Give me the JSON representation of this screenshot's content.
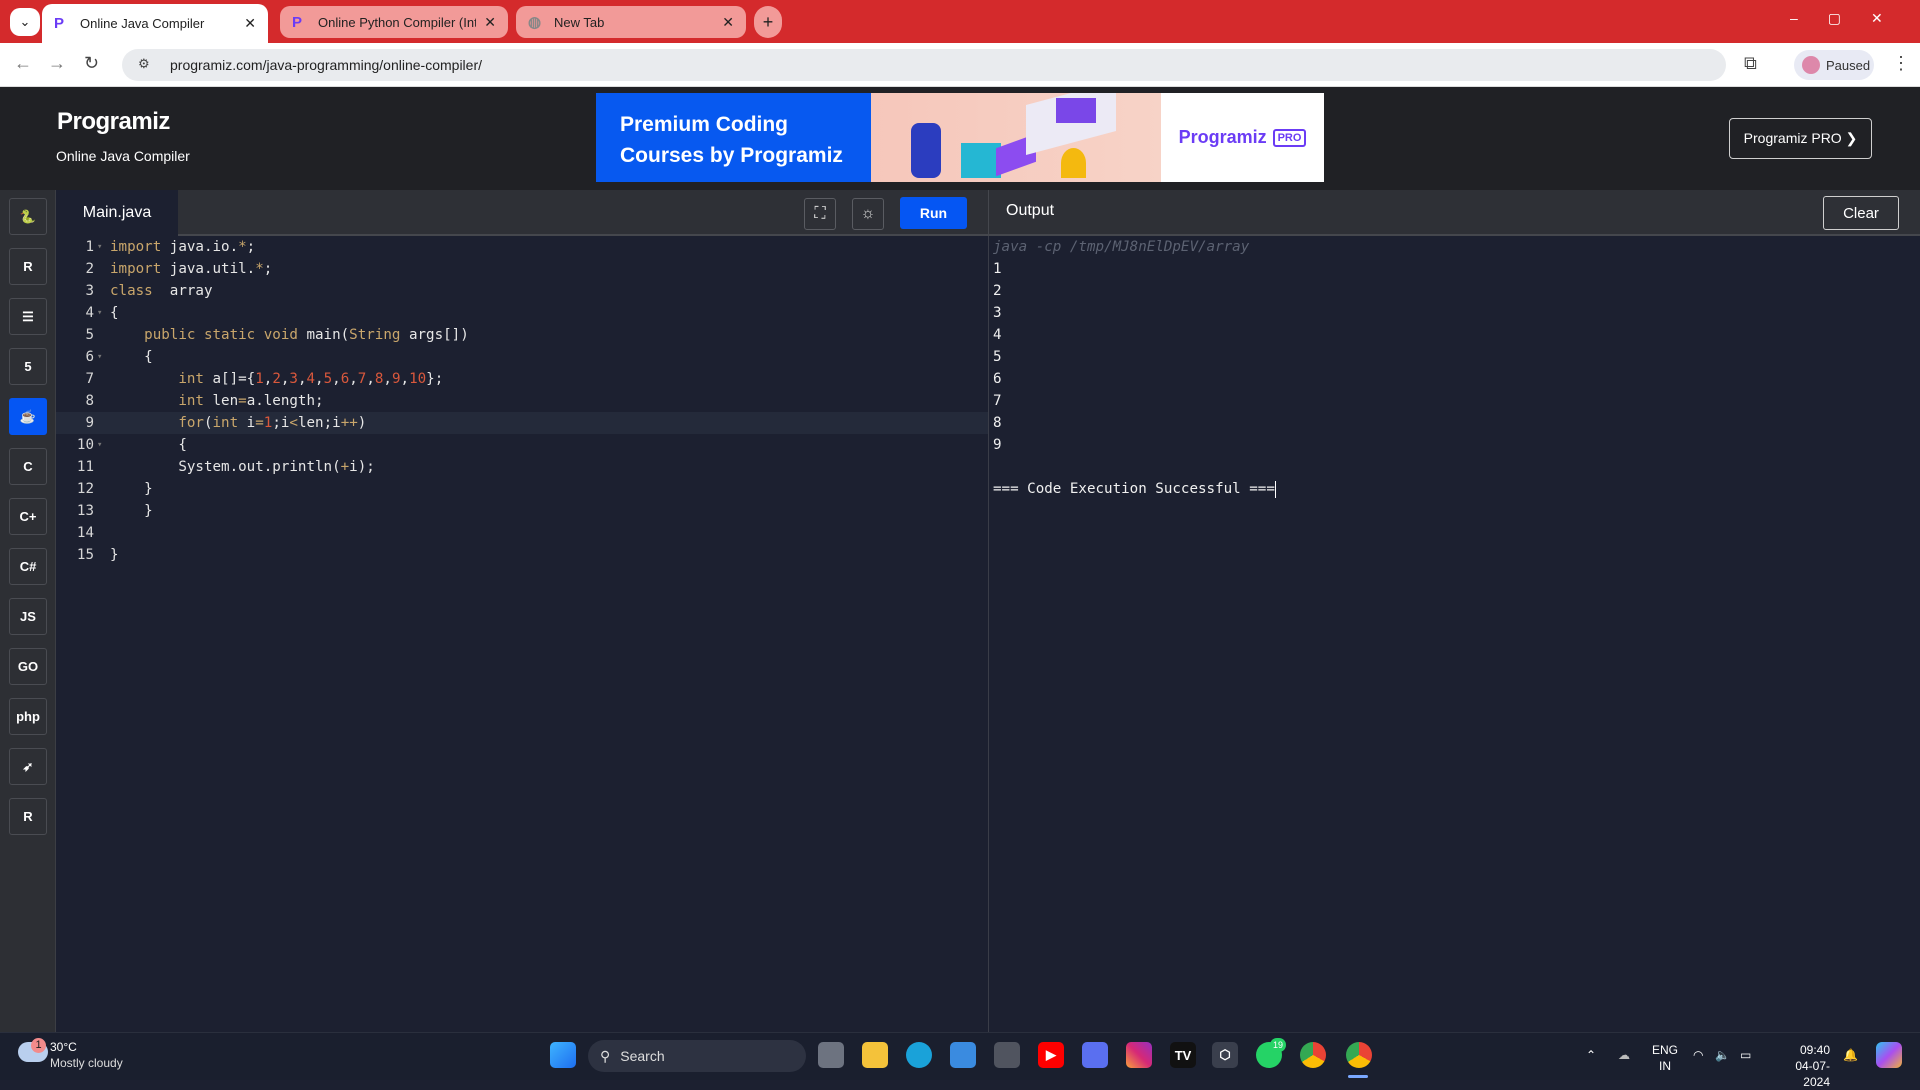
{
  "browser": {
    "tabs": [
      {
        "title": "Online Java Compiler",
        "active": true
      },
      {
        "title": "Online Python Compiler (Interpreter)",
        "active": false
      },
      {
        "title": "New Tab",
        "active": false
      }
    ],
    "url": "programiz.com/java-programming/online-compiler/",
    "profile_label": "Paused"
  },
  "header": {
    "logo": "Programiz",
    "subtitle": "Online Java Compiler",
    "ad_text_line1": "Premium Coding",
    "ad_text_line2": "Courses by Programiz",
    "ad_brand": "Programiz",
    "ad_badge": "PRO",
    "pro_button": "Programiz PRO ❯"
  },
  "sidebar": {
    "items": [
      {
        "name": "python",
        "glyph": "🐍"
      },
      {
        "name": "r",
        "glyph": "R"
      },
      {
        "name": "sql",
        "glyph": "☰"
      },
      {
        "name": "html",
        "glyph": "5"
      },
      {
        "name": "java",
        "glyph": "☕",
        "selected": true
      },
      {
        "name": "c",
        "glyph": "C"
      },
      {
        "name": "cpp",
        "glyph": "C+"
      },
      {
        "name": "csharp",
        "glyph": "C#"
      },
      {
        "name": "javascript",
        "glyph": "JS"
      },
      {
        "name": "go",
        "glyph": "GO"
      },
      {
        "name": "php",
        "glyph": "php"
      },
      {
        "name": "swift",
        "glyph": "➶"
      },
      {
        "name": "rust",
        "glyph": "R"
      }
    ]
  },
  "editor": {
    "filename": "Main.java",
    "run_label": "Run",
    "active_line": 9,
    "lines": [
      {
        "n": "1",
        "fold": true,
        "tokens": [
          [
            "import",
            "kw"
          ],
          [
            " java.io.",
            ""
          ],
          [
            "*",
            "op"
          ],
          [
            ";",
            ""
          ]
        ]
      },
      {
        "n": "2",
        "tokens": [
          [
            "import",
            "kw"
          ],
          [
            " java.util.",
            ""
          ],
          [
            "*",
            "op"
          ],
          [
            ";",
            ""
          ]
        ]
      },
      {
        "n": "3",
        "tokens": [
          [
            "class",
            "kw"
          ],
          [
            "  array",
            ""
          ]
        ]
      },
      {
        "n": "4",
        "fold": true,
        "tokens": [
          [
            "{",
            ""
          ]
        ]
      },
      {
        "n": "5",
        "tokens": [
          [
            "    ",
            ""
          ],
          [
            "public static void",
            "kw"
          ],
          [
            " main(",
            ""
          ],
          [
            "String",
            "kw"
          ],
          [
            " args[])",
            ""
          ]
        ]
      },
      {
        "n": "6",
        "fold": true,
        "tokens": [
          [
            "    {",
            ""
          ]
        ]
      },
      {
        "n": "7",
        "tokens": [
          [
            "        ",
            ""
          ],
          [
            "int",
            "kw"
          ],
          [
            " a[]={",
            ""
          ],
          [
            "1",
            "num"
          ],
          [
            ",",
            ""
          ],
          [
            "2",
            "num"
          ],
          [
            ",",
            ""
          ],
          [
            "3",
            "num"
          ],
          [
            ",",
            ""
          ],
          [
            "4",
            "num"
          ],
          [
            ",",
            ""
          ],
          [
            "5",
            "num"
          ],
          [
            ",",
            ""
          ],
          [
            "6",
            "num"
          ],
          [
            ",",
            ""
          ],
          [
            "7",
            "num"
          ],
          [
            ",",
            ""
          ],
          [
            "8",
            "num"
          ],
          [
            ",",
            ""
          ],
          [
            "9",
            "num"
          ],
          [
            ",",
            ""
          ],
          [
            "10",
            "num"
          ],
          [
            "};",
            ""
          ]
        ]
      },
      {
        "n": "8",
        "tokens": [
          [
            "        ",
            ""
          ],
          [
            "int",
            "kw"
          ],
          [
            " len",
            ""
          ],
          [
            "=",
            "op"
          ],
          [
            "a.length;",
            ""
          ]
        ]
      },
      {
        "n": "9",
        "tokens": [
          [
            "        ",
            ""
          ],
          [
            "for",
            "kw"
          ],
          [
            "(",
            ""
          ],
          [
            "int",
            "kw"
          ],
          [
            " i",
            ""
          ],
          [
            "=",
            "op"
          ],
          [
            "1",
            "num"
          ],
          [
            ";i",
            ""
          ],
          [
            "<",
            "op"
          ],
          [
            "len;i",
            ""
          ],
          [
            "++",
            "op"
          ],
          [
            ")",
            ""
          ]
        ]
      },
      {
        "n": "10",
        "fold": true,
        "tokens": [
          [
            "        {",
            ""
          ]
        ]
      },
      {
        "n": "11",
        "tokens": [
          [
            "        System.out.println(",
            ""
          ],
          [
            "+",
            "op"
          ],
          [
            "i);",
            ""
          ]
        ]
      },
      {
        "n": "12",
        "tokens": [
          [
            "    }",
            ""
          ]
        ]
      },
      {
        "n": "13",
        "tokens": [
          [
            "    }",
            ""
          ]
        ]
      },
      {
        "n": "14",
        "tokens": []
      },
      {
        "n": "15",
        "tokens": [
          [
            "}",
            ""
          ]
        ]
      }
    ]
  },
  "output": {
    "label": "Output",
    "clear_label": "Clear",
    "command": "java -cp /tmp/MJ8nElDpEV/array",
    "lines": [
      "1",
      "2",
      "3",
      "4",
      "5",
      "6",
      "7",
      "8",
      "9",
      ""
    ],
    "status": "=== Code Execution Successful ==="
  },
  "taskbar": {
    "weather_temp": "30°C",
    "weather_desc": "Mostly cloudy",
    "weather_badge": "1",
    "search_placeholder": "Search",
    "whatsapp_badge": "19",
    "lang_line1": "ENG",
    "lang_line2": "IN",
    "time": "09:40",
    "date": "04-07-2024"
  }
}
